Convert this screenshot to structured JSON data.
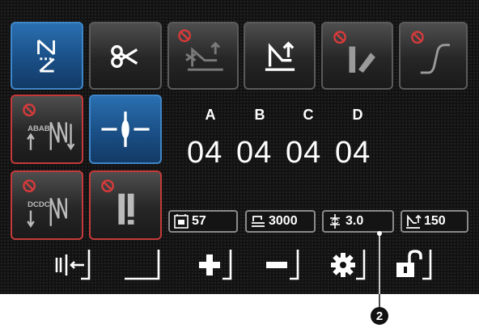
{
  "pattern_labels": [
    "A",
    "B",
    "C",
    "D"
  ],
  "pattern_values": [
    "04",
    "04",
    "04",
    "04"
  ],
  "status": {
    "counter": "57",
    "speed": "3000",
    "pitch": "3.0",
    "presser_height": "150"
  },
  "callout": "2",
  "colors": {
    "panel": "#121212",
    "button_border": "#5a5a5a",
    "active_blue": "#2a6fb0",
    "disabled_red": "#c43a3a",
    "text": "#ffffff"
  }
}
